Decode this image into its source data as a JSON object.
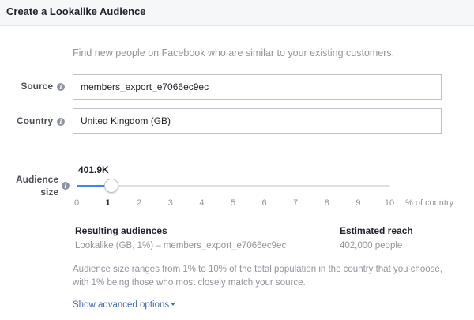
{
  "header": {
    "title": "Create a Lookalike Audience"
  },
  "intro": "Find new people on Facebook who are similar to your existing customers.",
  "source": {
    "label": "Source",
    "value": "members_export_e7066ec9ec"
  },
  "country": {
    "label": "Country",
    "value": "United Kingdom (GB)"
  },
  "audience_size": {
    "label_line1": "Audience",
    "label_line2": "size",
    "value_label": "401.9K",
    "selected_percent": 1,
    "min": 0,
    "max": 10,
    "ticks": [
      "0",
      "1",
      "2",
      "3",
      "4",
      "5",
      "6",
      "7",
      "8",
      "9",
      "10"
    ],
    "unit": "% of country"
  },
  "results": {
    "resulting_header": "Resulting audiences",
    "resulting_value": "Lookalike (GB, 1%) – members_export_e7066ec9ec",
    "reach_header": "Estimated reach",
    "reach_value": "402,000 people"
  },
  "note": "Audience size ranges from 1% to 10% of the total population in the country that you choose, with 1% being those who most closely match your source.",
  "advanced_link": "Show advanced options",
  "colors": {
    "accent": "#4080ff",
    "link": "#4267b2",
    "muted": "#90949c"
  },
  "icons": {
    "info": "info-icon",
    "caret": "caret-down-icon"
  }
}
